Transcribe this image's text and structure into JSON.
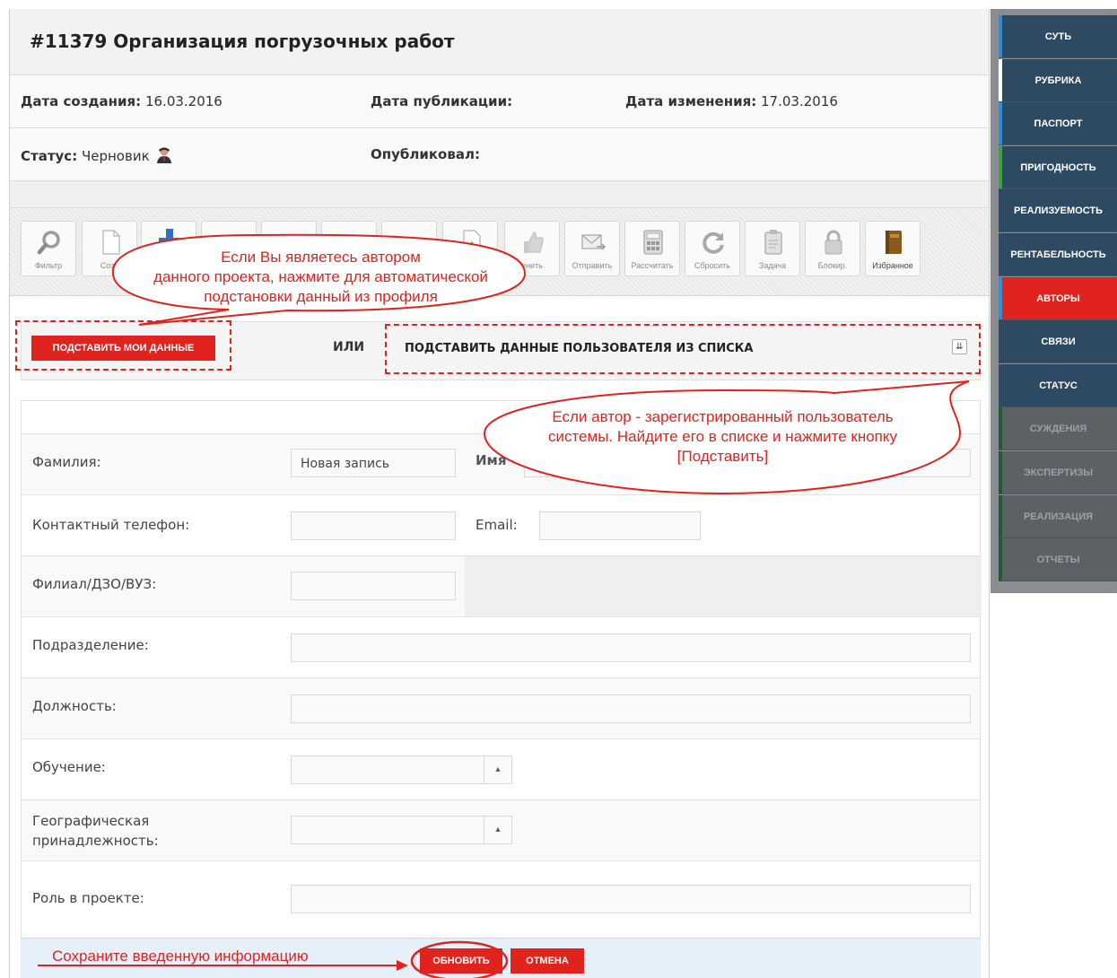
{
  "title": "#11379 Организация погрузочных работ",
  "meta": {
    "created_label": "Дата создания:",
    "created_value": "16.03.2016",
    "published_label": "Дата публикации:",
    "published_value": "",
    "changed_label": "Дата изменения:",
    "changed_value": "17.03.2016",
    "status_label": "Статус:",
    "status_value": "Черновик",
    "publisher_label": "Опубликовал:",
    "publisher_value": ""
  },
  "toolbar": {
    "buttons": [
      {
        "label": "Фильтр",
        "icon": "magnifier-icon"
      },
      {
        "label": "Созд",
        "icon": "new-document-icon"
      },
      {
        "label": "",
        "icon": "add-icon"
      },
      {
        "label": "",
        "icon": ""
      },
      {
        "label": "",
        "icon": ""
      },
      {
        "label": "",
        "icon": ""
      },
      {
        "label": "",
        "icon": ""
      },
      {
        "label": "",
        "icon": "document-up-icon"
      },
      {
        "label": "енить",
        "icon": "thumbs-up-icon"
      },
      {
        "label": "Отправить",
        "icon": "envelope-icon"
      },
      {
        "label": "Рассчитать",
        "icon": "calculator-icon"
      },
      {
        "label": "Сбросить",
        "icon": "refresh-icon"
      },
      {
        "label": "Задача",
        "icon": "clipboard-icon"
      },
      {
        "label": "Блокир.",
        "icon": "lock-icon"
      },
      {
        "label": "Избранное",
        "icon": "book-icon"
      }
    ]
  },
  "subst": {
    "mine_label": "ПОДСТАВИТЬ МОИ ДАННЫЕ",
    "or_label": "ИЛИ",
    "from_list_label": "ПОДСТАВИТЬ ДАННЫЕ ПОЛЬЗОВАТЕЛЯ ИЗ СПИСКА",
    "dropdown_icon": "double-chevron-down-icon"
  },
  "form": {
    "surname_label": "Фамилия:",
    "surname_value": "Новая запись",
    "name_label": "Имя",
    "phone_label": "Контактный телефон:",
    "phone_value": "",
    "email_label": "Email:",
    "email_value": "",
    "branch_label": "Филиал/ДЗО/ВУЗ:",
    "branch_value": "",
    "division_label": "Подразделение:",
    "division_value": "",
    "position_label": "Должность:",
    "position_value": "",
    "education_label": "Обучение:",
    "education_value": "",
    "geo_label_1": "Географическая",
    "geo_label_2": "принадлежность:",
    "geo_value": "",
    "role_label": "Роль в проекте:",
    "role_value": ""
  },
  "footer": {
    "hint": "Сохраните введенную информацию",
    "update_label": "ОБНОВИТЬ",
    "cancel_label": "ОТМЕНА"
  },
  "callouts": {
    "top_1": "Если Вы являетесь автором",
    "top_2": "данного проекта, нажмите для автоматической",
    "top_3": "подстановки данный из профиля",
    "right_1": "Если автор - зарегистрированный пользователь",
    "right_2": "системы. Найдите его в списке и нажмите кнопку",
    "right_3": "[Подставить]"
  },
  "sidebar": {
    "items": [
      {
        "label": "СУТЬ",
        "bar": "#2a8fdc",
        "bg": "#2d4a62",
        "fg": "#ffffff"
      },
      {
        "label": "РУБРИКА",
        "bar": "#ffffff",
        "bg": "#2d4a62",
        "fg": "#ffffff"
      },
      {
        "label": "ПАСПОРТ",
        "bar": "#2a8fdc",
        "bg": "#2d4a62",
        "fg": "#ffffff"
      },
      {
        "label": "ПРИГОДНОСТЬ",
        "bar": "#3aa443",
        "bg": "#2d4a62",
        "fg": "#ffffff"
      },
      {
        "label": "РЕАЛИЗУЕМОСТЬ",
        "bar": "#2d4a62",
        "bg": "#2d4a62",
        "fg": "#ffffff"
      },
      {
        "label": "РЕНТАБЕЛЬНОСТЬ",
        "bar": "#2d4a62",
        "bg": "#2d4a62",
        "fg": "#ffffff"
      },
      {
        "label": "АВТОРЫ",
        "bar": "#2a8fdc",
        "bg": "#e0241d",
        "fg": "#ffffff"
      },
      {
        "label": "СВЯЗИ",
        "bar": "#2d4a62",
        "bg": "#2d4a62",
        "fg": "#ffffff"
      },
      {
        "label": "СТАТУС",
        "bar": "#2d4a62",
        "bg": "#2d4a62",
        "fg": "#ffffff"
      },
      {
        "label": "СУЖДЕНИЯ",
        "bar": "#1f5a30",
        "bg": "#5d6166",
        "fg": "#9ca1a6"
      },
      {
        "label": "ЭКСПЕРТИЗЫ",
        "bar": "#1f5a30",
        "bg": "#5d6166",
        "fg": "#9ca1a6"
      },
      {
        "label": "РЕАЛИЗАЦИЯ",
        "bar": "#1f5a30",
        "bg": "#5d6166",
        "fg": "#9ca1a6"
      },
      {
        "label": "ОТЧЕТЫ",
        "bar": "#1f5a30",
        "bg": "#5d6166",
        "fg": "#9ca1a6"
      }
    ]
  },
  "colors": {
    "accent": "#e0241d",
    "nav": "#2d4a62",
    "footer_bg": "#e6f0fa"
  }
}
